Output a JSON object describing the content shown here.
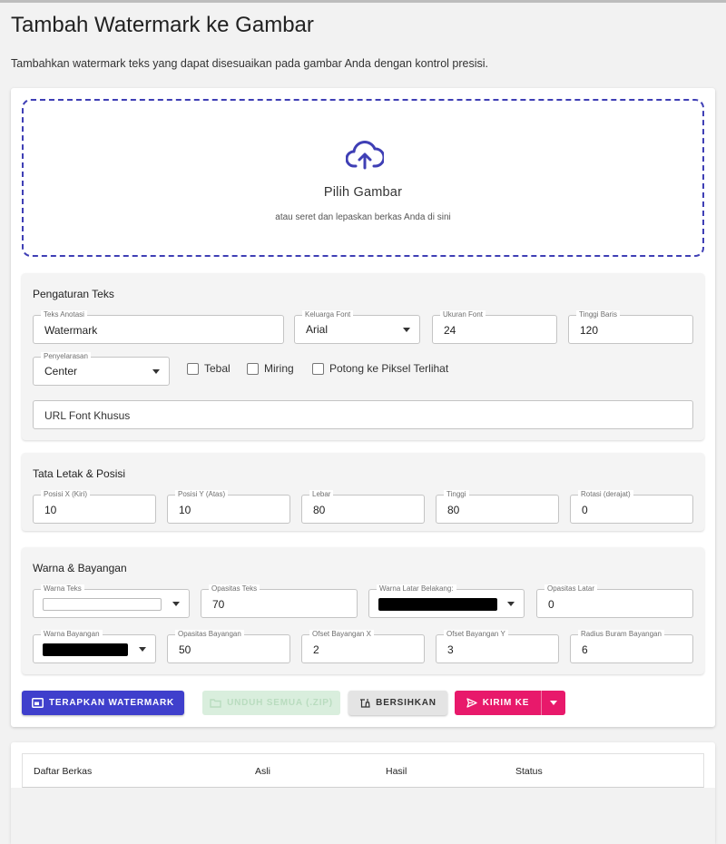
{
  "page": {
    "title": "Tambah Watermark ke Gambar",
    "description": "Tambahkan watermark teks yang dapat disesuaikan pada gambar Anda dengan kontrol presisi."
  },
  "dropzone": {
    "title": "Pilih Gambar",
    "subtitle": "atau seret dan lepaskan berkas Anda di sini"
  },
  "text_settings": {
    "title": "Pengaturan Teks",
    "annotation_text": {
      "label": "Teks Anotasi",
      "value": "Watermark"
    },
    "font_family": {
      "label": "Keluarga Font",
      "value": "Arial"
    },
    "font_size": {
      "label": "Ukuran Font",
      "value": "24"
    },
    "line_height": {
      "label": "Tinggi Baris",
      "value": "120"
    },
    "alignment": {
      "label": "Penyelarasan",
      "value": "Center"
    },
    "bold_label": "Tebal",
    "italic_label": "Miring",
    "crop_label": "Potong ke Piksel Terlihat",
    "custom_font_url_placeholder": "URL Font Khusus"
  },
  "layout": {
    "title": "Tata Letak & Posisi",
    "pos_x": {
      "label": "Posisi X (Kiri)",
      "value": "10"
    },
    "pos_y": {
      "label": "Posisi Y (Atas)",
      "value": "10"
    },
    "width": {
      "label": "Lebar",
      "value": "80"
    },
    "height": {
      "label": "Tinggi",
      "value": "80"
    },
    "rotation": {
      "label": "Rotasi (derajat)",
      "value": "0"
    }
  },
  "colors": {
    "title": "Warna & Bayangan",
    "text_color": {
      "label": "Warna Teks",
      "value": "#ffffff"
    },
    "text_opacity": {
      "label": "Opasitas Teks",
      "value": "70"
    },
    "bg_color": {
      "label": "Warna Latar Belakang:",
      "value": "#000000"
    },
    "bg_opacity": {
      "label": "Opasitas Latar",
      "value": "0"
    },
    "shadow_color": {
      "label": "Warna Bayangan",
      "value": "#000000"
    },
    "shadow_opacity": {
      "label": "Opasitas Bayangan",
      "value": "50"
    },
    "shadow_offset_x": {
      "label": "Ofset Bayangan X",
      "value": "2"
    },
    "shadow_offset_y": {
      "label": "Ofset Bayangan Y",
      "value": "3"
    },
    "shadow_blur": {
      "label": "Radius Buram Bayangan",
      "value": "6"
    }
  },
  "actions": {
    "apply": "TERAPKAN WATERMARK",
    "download_all": "UNDUH SEMUA (.ZIP)",
    "clear": "BERSIHKAN",
    "send_to": "KIRIM KE"
  },
  "file_table": {
    "headers": [
      "Daftar Berkas",
      "Asli",
      "Hasil",
      "Status"
    ]
  },
  "theme": {
    "primary": "#3f3fcc",
    "accent": "#e8196b",
    "dropzone_border": "#3f3fb5"
  },
  "icons": {
    "upload": "cloud-upload-icon",
    "apply": "image-frame-icon",
    "download": "folder-icon",
    "clear": "broom-icon",
    "send": "send-icon"
  }
}
